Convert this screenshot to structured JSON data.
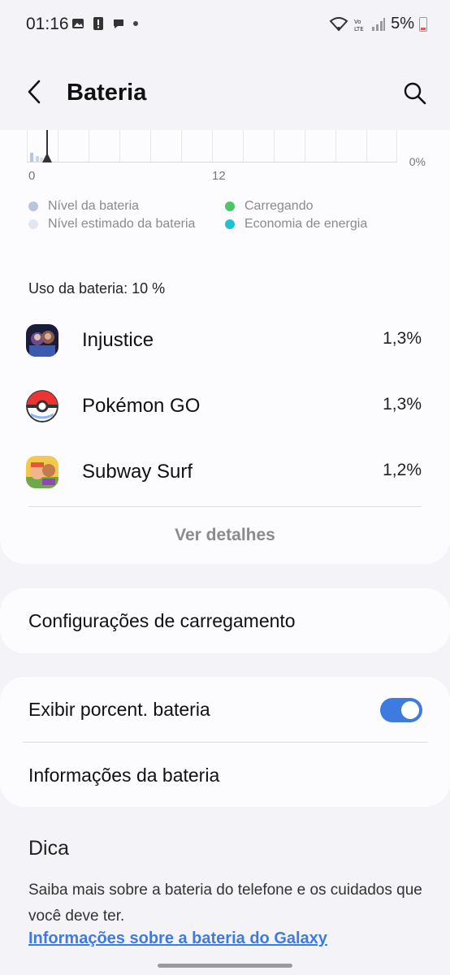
{
  "status_bar": {
    "time": "01:16",
    "battery_percent": "5%",
    "icons": [
      "image-icon",
      "alert-icon",
      "chat-icon",
      "dot-icon",
      "wifi-icon",
      "volte-icon",
      "signal-icon",
      "battery-icon"
    ]
  },
  "header": {
    "title": "Bateria",
    "back_icon": "back-icon",
    "search_icon": "search-icon"
  },
  "chart_data": {
    "type": "bar",
    "x_tick_labels": [
      "0",
      "12"
    ],
    "y_tick_label": "0%",
    "legend": [
      {
        "label": "Nível da bateria",
        "color": "#b9c4de"
      },
      {
        "label": "Nível estimado da bateria",
        "color": "#e2e6ef"
      },
      {
        "label": "Carregando",
        "color": "#4cc764"
      },
      {
        "label": "Economia de energia",
        "color": "#20c1d4"
      }
    ]
  },
  "usage": {
    "title": "Uso da bateria: 10 %",
    "apps": [
      {
        "name": "Injustice",
        "percent": "1,3%",
        "icon": "injustice-icon"
      },
      {
        "name": "Pokémon GO",
        "percent": "1,3%",
        "icon": "pokeball-icon"
      },
      {
        "name": "Subway Surf",
        "percent": "1,2%",
        "icon": "subway-surf-icon"
      }
    ],
    "details_label": "Ver detalhes"
  },
  "settings": {
    "charging_label": "Configurações de carregamento",
    "show_percent_label": "Exibir porcent. bateria",
    "show_percent_on": true,
    "battery_info_label": "Informações da bateria"
  },
  "tip": {
    "title": "Dica",
    "text": "Saiba mais sobre a bateria do telefone e os cuidados que você deve ter.",
    "link": "Informações sobre a bateria do Galaxy"
  },
  "colors": {
    "accent": "#3e7be0",
    "background": "#f4f3f8",
    "card": "#fcfcfe"
  }
}
